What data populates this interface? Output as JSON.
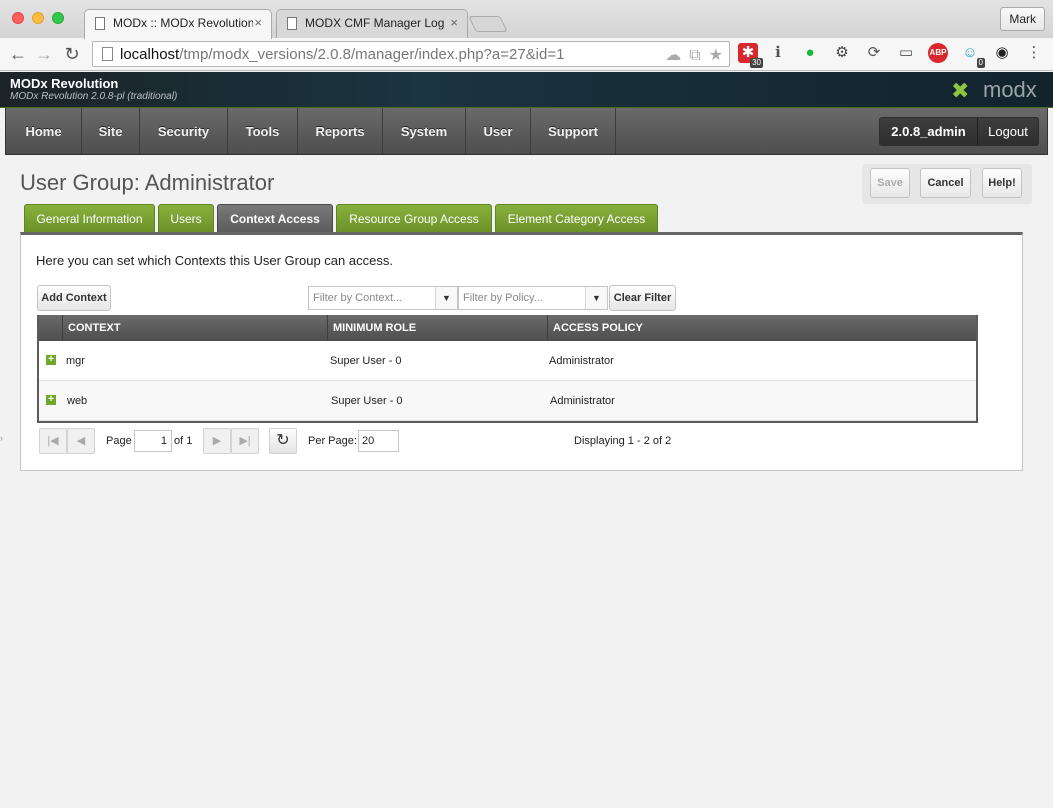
{
  "browser": {
    "tabs": [
      {
        "title": "MODx :: MODx Revolution",
        "active": true
      },
      {
        "title": "MODX CMF Manager Login",
        "active": false
      }
    ],
    "tab_close": "×",
    "profile": "Mark",
    "url_host": "localhost",
    "url_path": "/tmp/modx_versions/2.0.8/manager/index.php?a=27&id=1",
    "nav": {
      "back": "←",
      "forward": "→",
      "reload": "↻"
    },
    "extensions": [
      {
        "name": "extension-red-icon",
        "glyph": "✱",
        "badge": "30",
        "color": "#d9272e"
      },
      {
        "name": "info-icon",
        "glyph": "ℹ",
        "color": "#555555"
      },
      {
        "name": "chat-bubble-icon",
        "glyph": "●",
        "color": "#16b53c"
      },
      {
        "name": "gear-icon",
        "glyph": "⚙",
        "color": "#444444"
      },
      {
        "name": "sync-icon",
        "glyph": "⟳",
        "color": "#555555"
      },
      {
        "name": "cast-icon",
        "glyph": "▭",
        "color": "#555555"
      },
      {
        "name": "adblock-icon",
        "glyph": "ABP",
        "color": "#d9272e"
      },
      {
        "name": "ghost-icon",
        "glyph": "☺",
        "badge": "0",
        "color": "#2c9fd9"
      },
      {
        "name": "eye-icon",
        "glyph": "◉",
        "color": "#222222"
      },
      {
        "name": "menu-icon",
        "glyph": "⋮",
        "color": "#444444"
      }
    ]
  },
  "header": {
    "site_name": "MODx Revolution",
    "version": "MODx Revolution 2.0.8-pl (traditional)",
    "logo_text": "modx"
  },
  "mainnav": {
    "items": [
      "Home",
      "Site",
      "Security",
      "Tools",
      "Reports",
      "System",
      "User",
      "Support"
    ],
    "username": "2.0.8_admin",
    "logout": "Logout"
  },
  "page": {
    "title": "User Group: Administrator",
    "actions": {
      "save": "Save",
      "cancel": "Cancel",
      "help": "Help!"
    },
    "tabs": [
      "General Information",
      "Users",
      "Context Access",
      "Resource Group Access",
      "Element Category Access"
    ],
    "active_tab": "Context Access",
    "description": "Here you can set which Contexts this User Group can access.",
    "add_context": "Add Context",
    "filter_context_placeholder": "Filter by Context...",
    "filter_policy_placeholder": "Filter by Policy...",
    "clear_filter": "Clear Filter",
    "grid": {
      "columns": [
        "CONTEXT",
        "MINIMUM ROLE",
        "ACCESS POLICY"
      ],
      "rows": [
        {
          "context": "mgr",
          "role": "Super User - 0",
          "policy": "Administrator"
        },
        {
          "context": "web",
          "role": "Super User - 0",
          "policy": "Administrator"
        }
      ]
    },
    "pager": {
      "page_label": "Page",
      "page_value": "1",
      "of_label": "of 1",
      "per_page_label": "Per Page:",
      "per_page_value": "20",
      "displaying": "Displaying 1 - 2 of 2"
    }
  }
}
